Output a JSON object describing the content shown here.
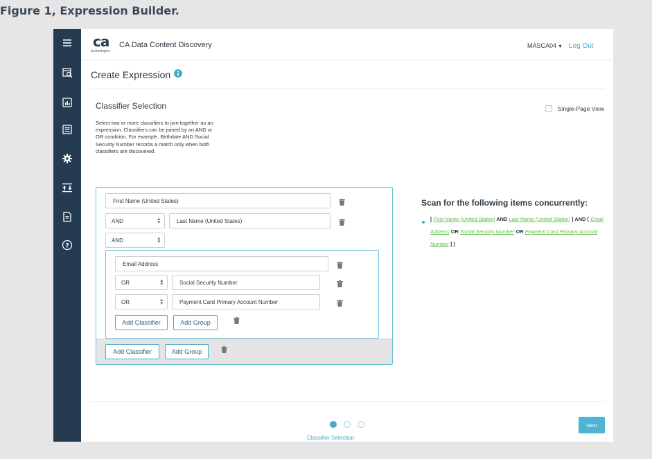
{
  "caption": "Figure 1, Expression Builder.",
  "header": {
    "logo_text": "ca",
    "logo_sub": "technologies",
    "product_name": "CA Data Content Discovery",
    "user": "MASCA04",
    "logout": "Log Out"
  },
  "page": {
    "title": "Create Expression",
    "section_title": "Classifier Selection",
    "single_page_label": "Single-Page View",
    "description": "Select two or more classifiers to join together as an expression. Classifiers can be joined by an AND or OR condition. For example, Birthdate AND Social Security Number records a match only when both classifiers are discovered."
  },
  "builder": {
    "row1_classifier": "First Name (United States)",
    "row2_operator": "AND",
    "row2_classifier": "Last Name (United States)",
    "row3_operator": "AND",
    "group": {
      "row1_classifier": "Email Address",
      "row2_operator": "OR",
      "row2_classifier": "Social Security Number",
      "row3_operator": "OR",
      "row3_classifier": "Payment Card Primary Account Number",
      "add_classifier": "Add Classifier",
      "add_group": "Add Group"
    },
    "add_classifier": "Add Classifier",
    "add_group": "Add Group"
  },
  "scan": {
    "title": "Scan for the following items concurrently:",
    "open_bracket": "[",
    "first_name": "First Name (United States)",
    "and1": "AND",
    "last_name": "Last Name (United States)",
    "close_and": "] AND [",
    "email": "Email Address",
    "or1": "OR",
    "ssn": "Social Security Number",
    "or2": "OR",
    "pan": "Payment Card Primary Account Number",
    "close_bracket": "] ]"
  },
  "footer": {
    "step_label": "Classifier Selection",
    "next": "Next"
  },
  "colors": {
    "sidebar": "#243b52",
    "accent": "#4aa8c9",
    "link_green": "#5dbb47"
  }
}
